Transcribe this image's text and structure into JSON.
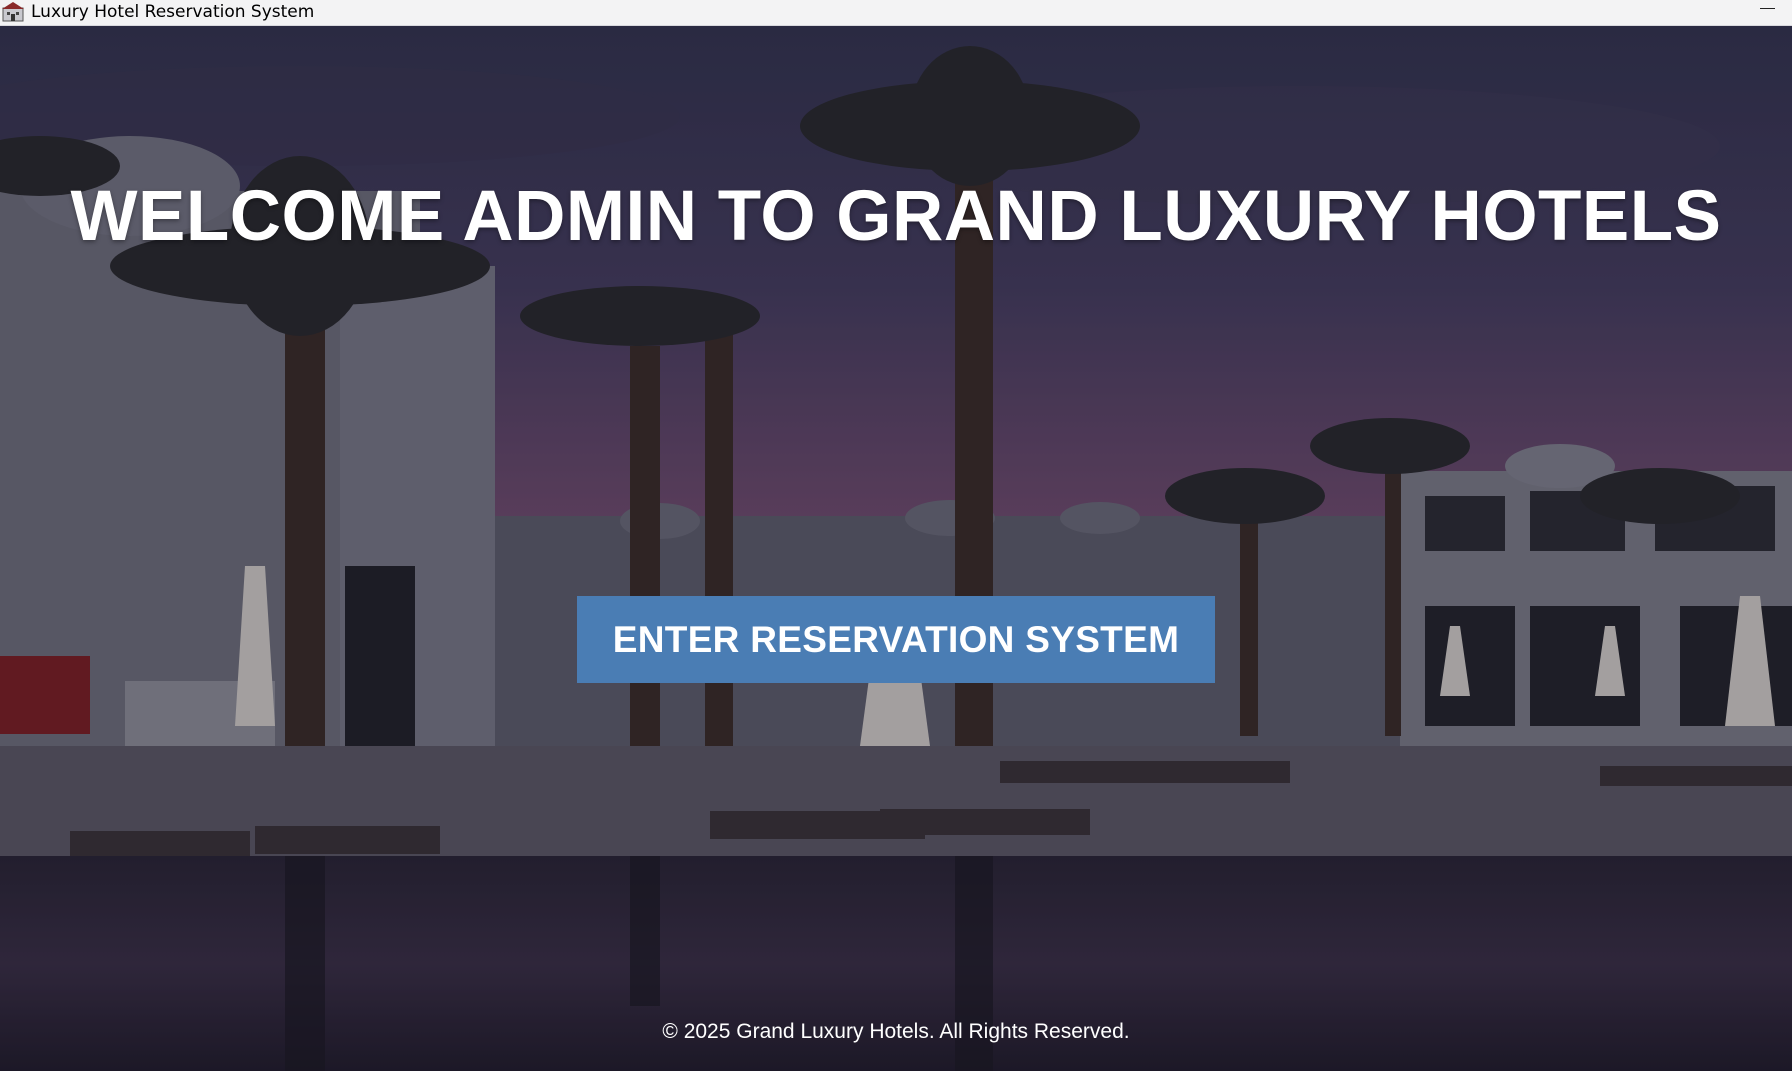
{
  "window": {
    "title": "Luxury Hotel Reservation System",
    "icon": "hotel-app-icon",
    "minimize_icon": "minimize-icon"
  },
  "main": {
    "headline": "WELCOME ADMIN TO GRAND LUXURY HOTELS",
    "enter_button_label": "ENTER RESERVATION SYSTEM",
    "footer": "© 2025 Grand Luxury Hotels. All Rights Reserved."
  },
  "colors": {
    "button": "#4a7db4",
    "sky_top": "#3a3a55",
    "sky_glow": "#6a4a6e",
    "text": "#ffffff"
  }
}
